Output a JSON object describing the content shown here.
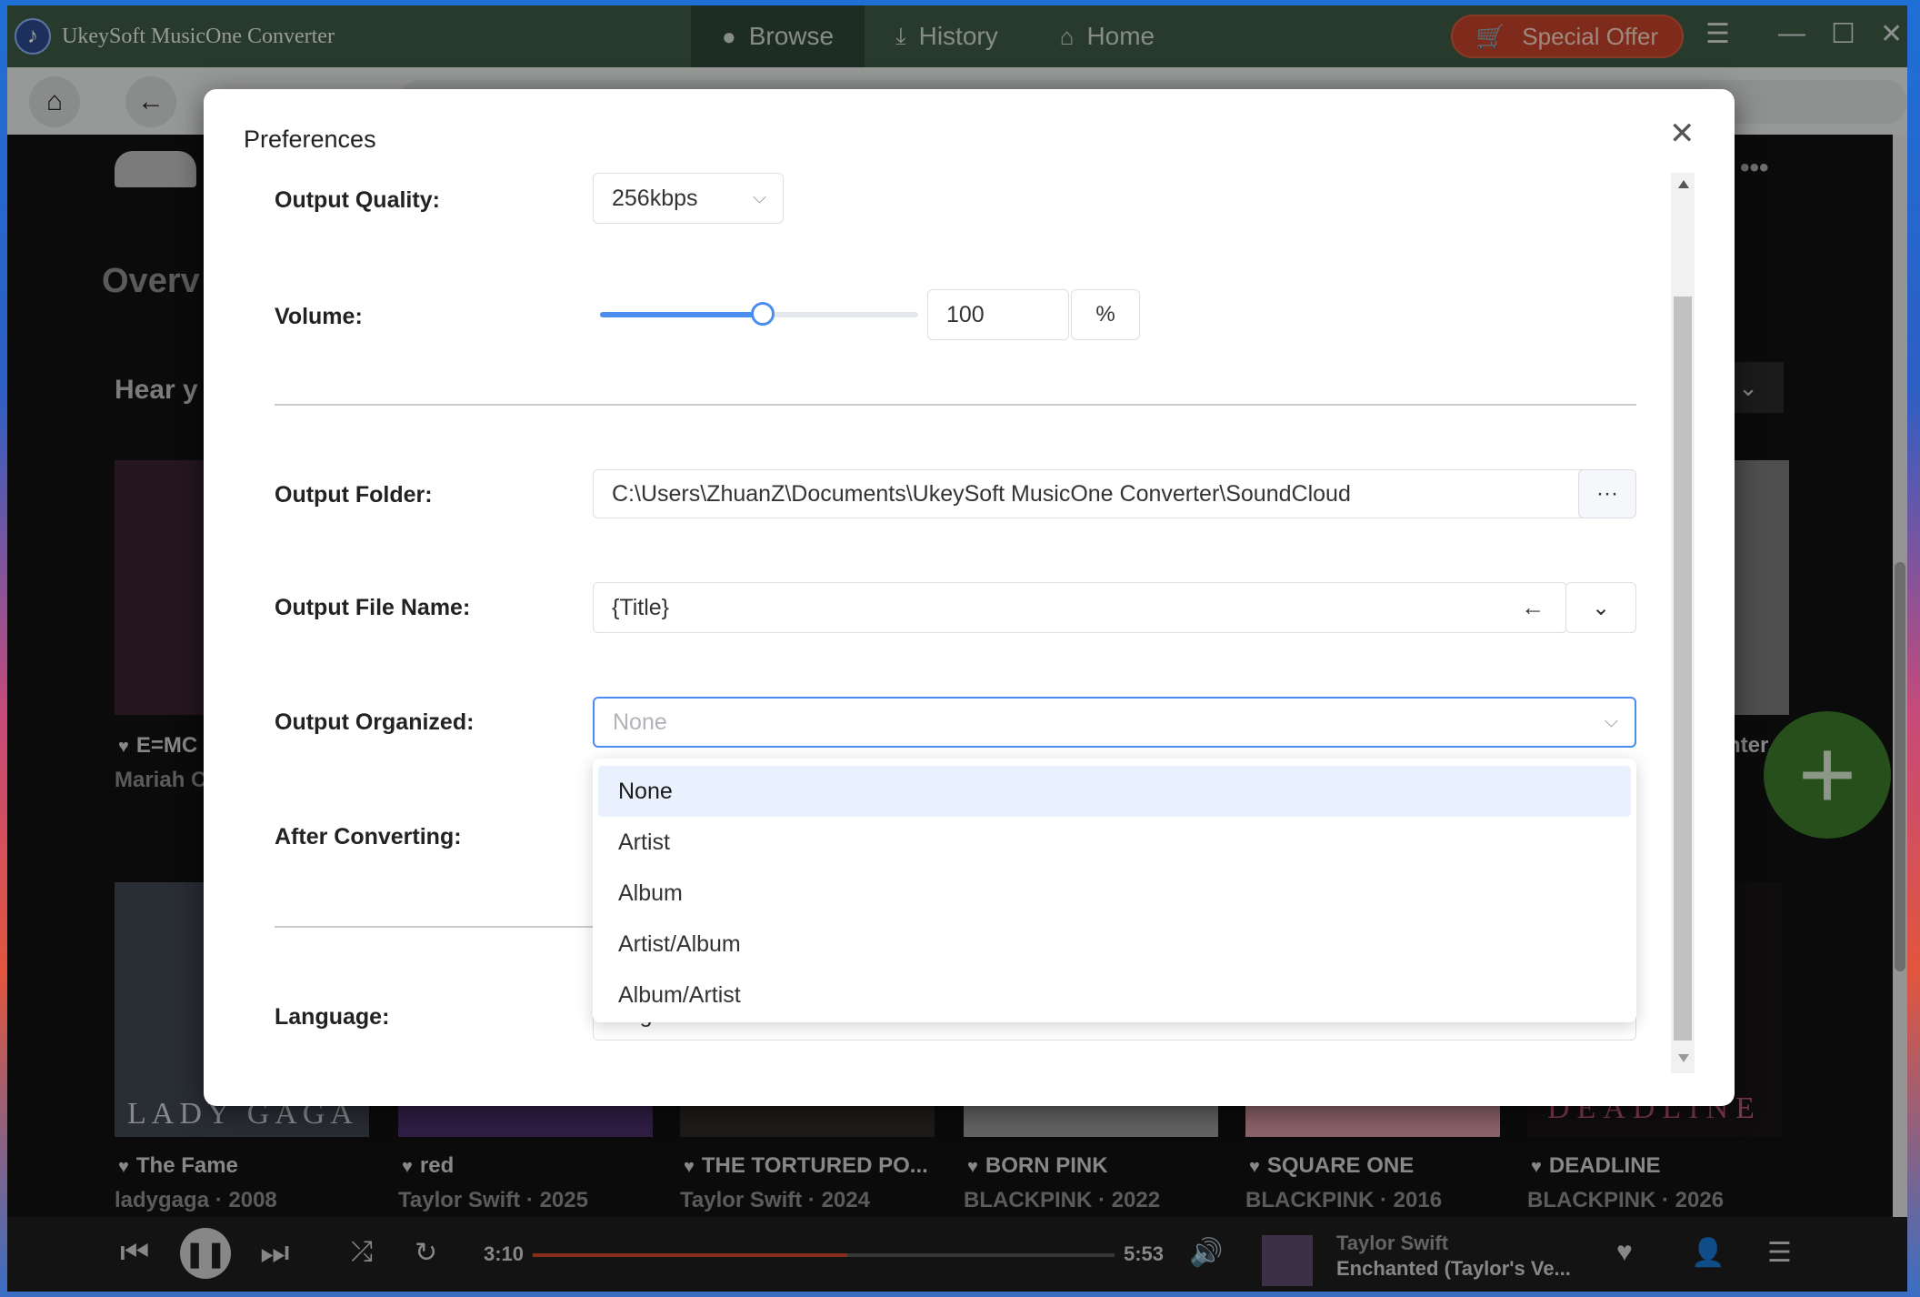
{
  "window": {
    "title": "UkeySoft MusicOne Converter",
    "nav_tabs": [
      {
        "label": "Browse",
        "icon": "globe-icon"
      },
      {
        "label": "History",
        "icon": "download-icon"
      },
      {
        "label": "Home",
        "icon": "home-icon"
      }
    ],
    "special_offer": "Special Offer"
  },
  "background": {
    "overview_partial": "Overv",
    "hear_partial": "Hear y",
    "albums_row1": [
      {
        "name": "E=MC",
        "sub": "Mariah C"
      },
      {
        "name": "nter..",
        "sub": ""
      }
    ],
    "albums_row2": [
      {
        "name": "The Fame",
        "sub": "ladygaga · 2008",
        "art_text": "LADY GAGA"
      },
      {
        "name": "red",
        "sub": "Taylor Swift · 2025"
      },
      {
        "name": "THE TORTURED PO...",
        "sub": "Taylor Swift · 2024"
      },
      {
        "name": "BORN PINK",
        "sub": "BLACKPINK · 2022"
      },
      {
        "name": "SQUARE ONE",
        "sub": "BLACKPINK · 2016"
      },
      {
        "name": "DEADLINE",
        "sub": "BLACKPINK · 2026",
        "art_text": "DEADLINE"
      }
    ]
  },
  "player": {
    "current_time": "3:10",
    "total_time": "5:53",
    "progress": 0.54,
    "artist": "Taylor Swift",
    "song": "Enchanted (Taylor's Ve..."
  },
  "preferences": {
    "title": "Preferences",
    "output_quality": {
      "label": "Output Quality:",
      "value": "256kbps"
    },
    "volume": {
      "label": "Volume:",
      "value": "100",
      "unit": "%",
      "level": 0.5
    },
    "output_folder": {
      "label": "Output Folder:",
      "value": "C:\\Users\\ZhuanZ\\Documents\\UkeySoft MusicOne Converter\\SoundCloud",
      "browse": "···"
    },
    "output_file_name": {
      "label": "Output File Name:",
      "value": "{Title}"
    },
    "output_organized": {
      "label": "Output Organized:",
      "placeholder": "None",
      "options": [
        "None",
        "Artist",
        "Album",
        "Artist/Album",
        "Album/Artist"
      ],
      "selected_index": 0
    },
    "after_converting": {
      "label": "After Converting:"
    },
    "language": {
      "label": "Language:",
      "value": "English"
    }
  }
}
